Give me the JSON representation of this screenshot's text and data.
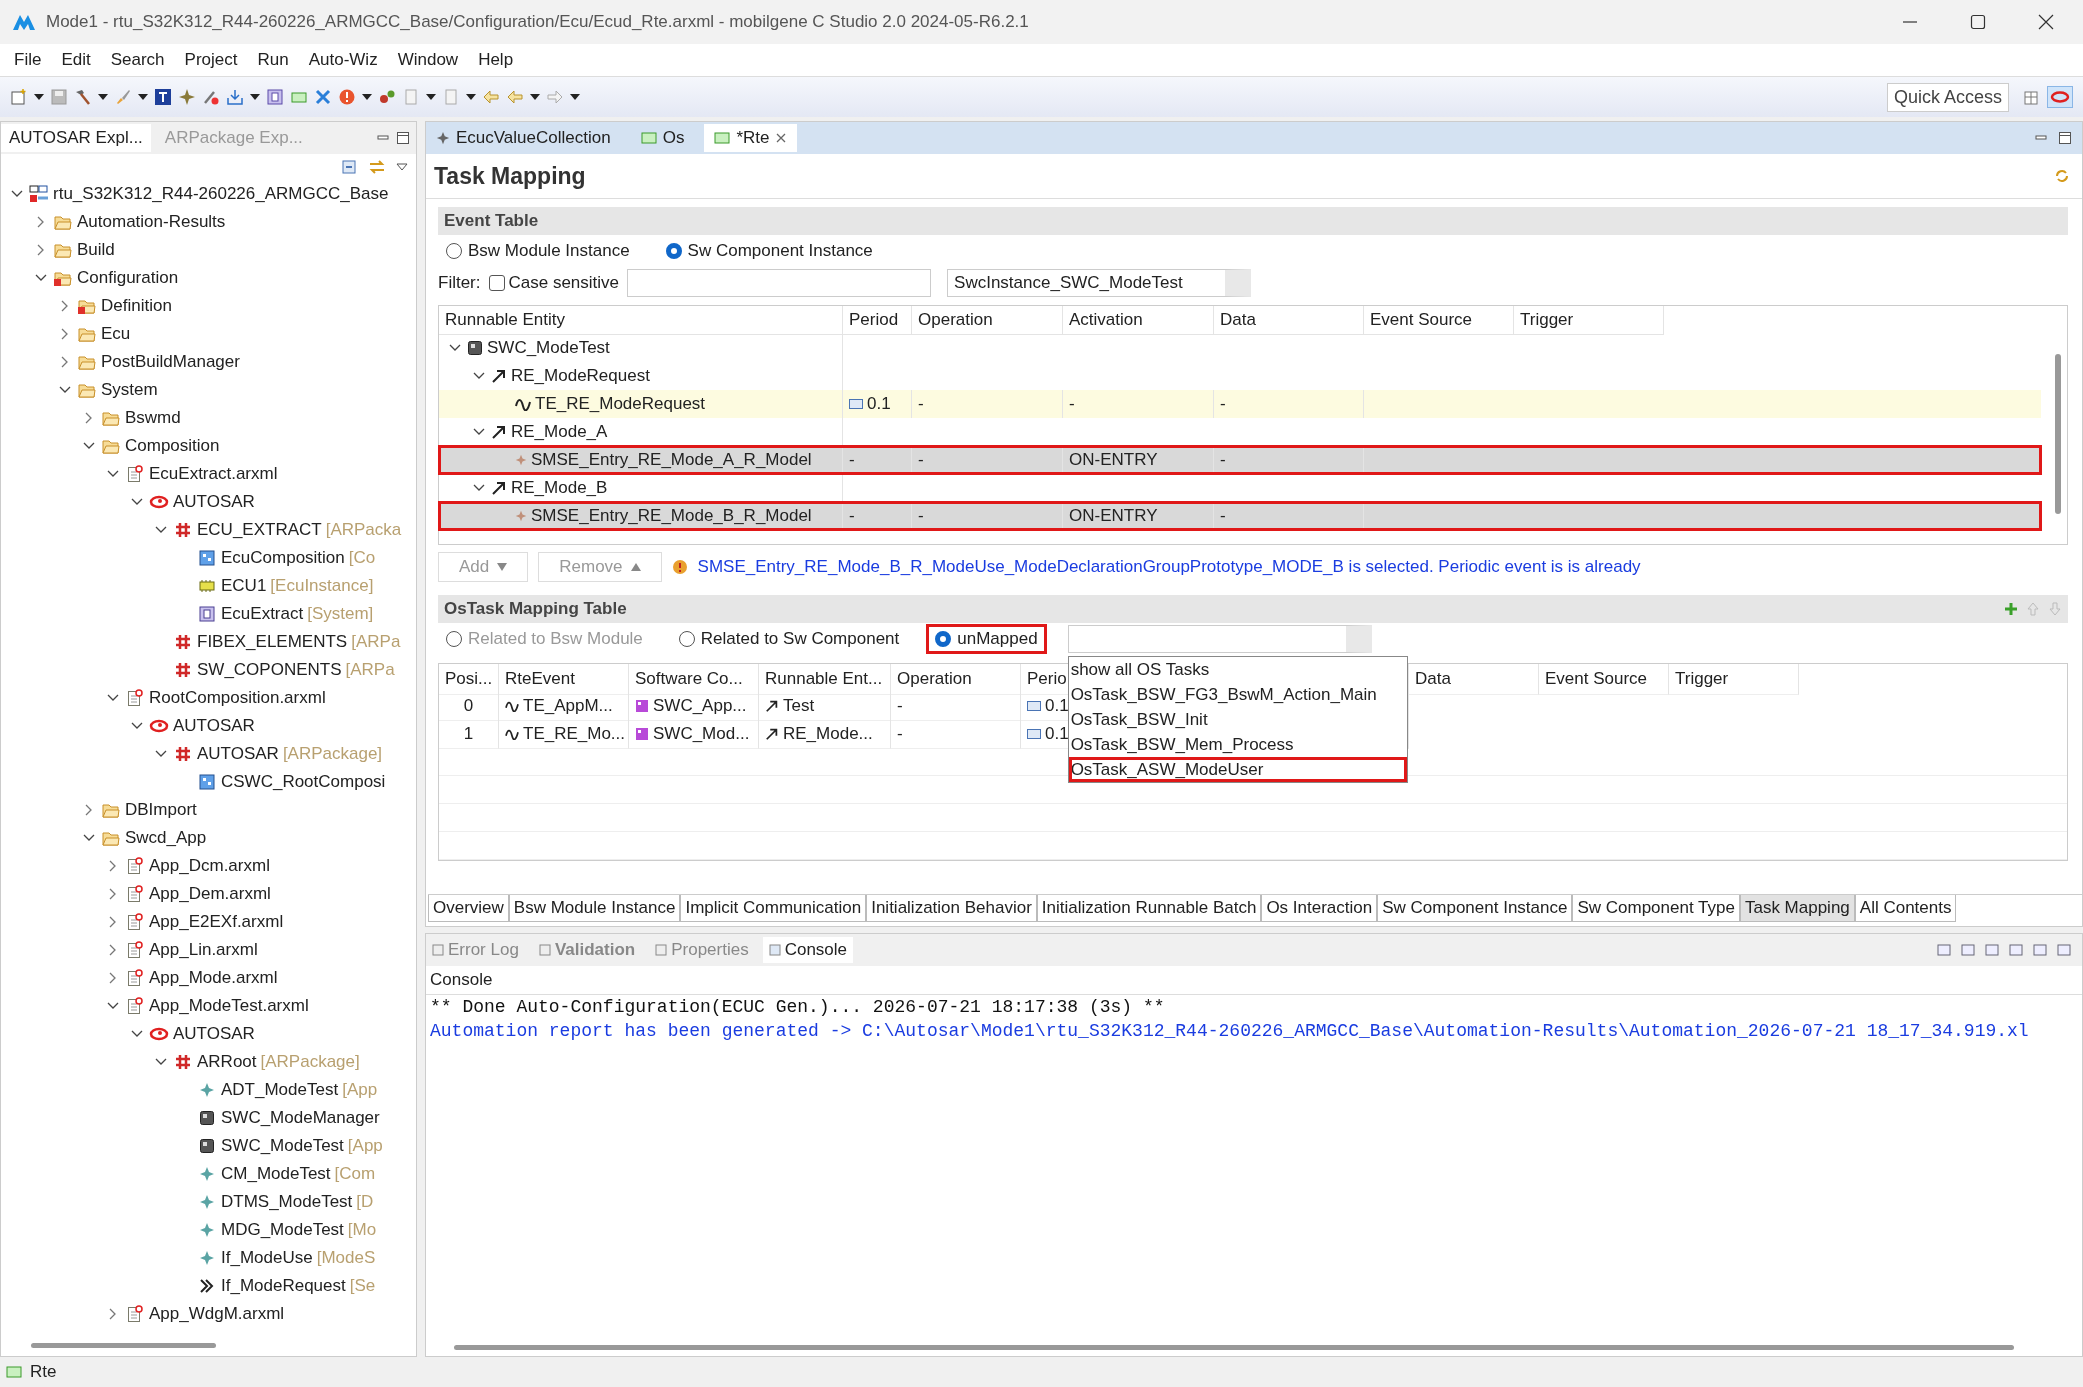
{
  "window": {
    "title": "Mode1 - rtu_S32K312_R44-260226_ARMGCC_Base/Configuration/Ecu/Ecud_Rte.arxml - mobilgene C Studio 2.0 2024-05-R6.2.1"
  },
  "menu": [
    "File",
    "Edit",
    "Search",
    "Project",
    "Run",
    "Auto-Wiz",
    "Window",
    "Help"
  ],
  "quick_access": "Quick Access",
  "left_tabs": [
    {
      "label": "AUTOSAR Expl...",
      "selected": true
    },
    {
      "label": "ARPackage Exp...",
      "selected": false
    }
  ],
  "tree": [
    {
      "label": "rtu_S32K312_R44-260226_ARMGCC_Base",
      "kind": "project",
      "expanded": true,
      "children": [
        {
          "label": "Automation-Results",
          "kind": "folder",
          "expanded": false
        },
        {
          "label": "Build",
          "kind": "folder",
          "expanded": false
        },
        {
          "label": "Configuration",
          "kind": "errfolder",
          "expanded": true,
          "children": [
            {
              "label": "Definition",
              "kind": "errfolder",
              "expanded": false
            },
            {
              "label": "Ecu",
              "kind": "folder",
              "expanded": false
            },
            {
              "label": "PostBuildManager",
              "kind": "folder",
              "expanded": false
            },
            {
              "label": "System",
              "kind": "folder",
              "expanded": true,
              "children": [
                {
                  "label": "Bswmd",
                  "kind": "folder",
                  "expanded": false
                },
                {
                  "label": "Composition",
                  "kind": "folder",
                  "expanded": true,
                  "children": [
                    {
                      "label": "EcuExtract.arxml",
                      "kind": "file",
                      "expanded": true,
                      "children": [
                        {
                          "label": "AUTOSAR",
                          "kind": "autosar",
                          "expanded": true,
                          "children": [
                            {
                              "label": "ECU_EXTRACT",
                              "type": "[ARPacka",
                              "kind": "package",
                              "expanded": true,
                              "children": [
                                {
                                  "label": "EcuComposition",
                                  "type": "[Co",
                                  "kind": "composition"
                                },
                                {
                                  "label": "ECU1",
                                  "type": "[EcuInstance]",
                                  "kind": "ecu"
                                },
                                {
                                  "label": "EcuExtract",
                                  "type": "[System]",
                                  "kind": "system"
                                }
                              ]
                            },
                            {
                              "label": "FIBEX_ELEMENTS",
                              "type": "[ARPa",
                              "kind": "package"
                            },
                            {
                              "label": "SW_COPONENTS",
                              "type": "[ARPa",
                              "kind": "package"
                            }
                          ]
                        }
                      ]
                    },
                    {
                      "label": "RootComposition.arxml",
                      "kind": "file",
                      "expanded": true,
                      "children": [
                        {
                          "label": "AUTOSAR",
                          "kind": "autosar",
                          "expanded": true,
                          "children": [
                            {
                              "label": "AUTOSAR",
                              "type": "[ARPackage]",
                              "kind": "package",
                              "expanded": true,
                              "children": [
                                {
                                  "label": "CSWC_RootComposi",
                                  "kind": "composition"
                                }
                              ]
                            }
                          ]
                        }
                      ]
                    }
                  ]
                },
                {
                  "label": "DBImport",
                  "kind": "folder",
                  "expanded": false
                },
                {
                  "label": "Swcd_App",
                  "kind": "folder",
                  "expanded": true,
                  "children": [
                    {
                      "label": "App_Dcm.arxml",
                      "kind": "file",
                      "expanded": false
                    },
                    {
                      "label": "App_Dem.arxml",
                      "kind": "file",
                      "expanded": false
                    },
                    {
                      "label": "App_E2EXf.arxml",
                      "kind": "file",
                      "expanded": false
                    },
                    {
                      "label": "App_Lin.arxml",
                      "kind": "file",
                      "expanded": false
                    },
                    {
                      "label": "App_Mode.arxml",
                      "kind": "file",
                      "expanded": false
                    },
                    {
                      "label": "App_ModeTest.arxml",
                      "kind": "file",
                      "expanded": true,
                      "children": [
                        {
                          "label": "AUTOSAR",
                          "kind": "autosar",
                          "expanded": true,
                          "children": [
                            {
                              "label": "ARRoot",
                              "type": "[ARPackage]",
                              "kind": "package",
                              "expanded": true,
                              "children": [
                                {
                                  "label": "ADT_ModeTest",
                                  "type": "[App",
                                  "kind": "element"
                                },
                                {
                                  "label": "SWC_ModeManager",
                                  "kind": "swc"
                                },
                                {
                                  "label": "SWC_ModeTest",
                                  "type": "[App",
                                  "kind": "swc"
                                },
                                {
                                  "label": "CM_ModeTest",
                                  "type": "[Com",
                                  "kind": "element"
                                },
                                {
                                  "label": "DTMS_ModeTest",
                                  "type": "[D",
                                  "kind": "element"
                                },
                                {
                                  "label": "MDG_ModeTest",
                                  "type": "[Mo",
                                  "kind": "element"
                                },
                                {
                                  "label": "If_ModeUse",
                                  "type": "[ModeS",
                                  "kind": "element"
                                },
                                {
                                  "label": "If_ModeRequest",
                                  "type": "[Se",
                                  "kind": "interface"
                                }
                              ]
                            }
                          ]
                        }
                      ]
                    },
                    {
                      "label": "App_WdgM.arxml",
                      "kind": "file",
                      "expanded": false
                    }
                  ]
                }
              ]
            }
          ]
        }
      ]
    }
  ],
  "editor_tabs": [
    {
      "label": "EcucValueCollection",
      "kind": "element",
      "selected": false
    },
    {
      "label": "Os",
      "kind": "editor",
      "selected": false
    },
    {
      "label": "*Rte",
      "kind": "editor",
      "selected": true
    }
  ],
  "page_title": "Task Mapping",
  "event_table": {
    "title": "Event Table",
    "radios": [
      {
        "label": "Bsw Module Instance",
        "selected": false
      },
      {
        "label": "Sw Component Instance",
        "selected": true
      }
    ],
    "filter_label": "Filter:",
    "case_sensitive": {
      "label": "Case sensitive",
      "checked": false
    },
    "instance": "SwcInstance_SWC_ModeTest",
    "columns": [
      "Runnable Entity",
      "Period",
      "Operation",
      "Activation",
      "Data",
      "Event Source",
      "Trigger"
    ],
    "rows": [
      {
        "name": "SWC_ModeTest",
        "kind": "swc",
        "expanded": true,
        "children": [
          {
            "name": "RE_ModeRequest",
            "kind": "runnable",
            "expanded": true,
            "children": [
              {
                "name": "TE_RE_ModeRequest",
                "kind": "timing",
                "selected": true,
                "outlined": false,
                "cells": [
                  "0.1",
                  "-",
                  "-",
                  "-"
                ]
              }
            ]
          },
          {
            "name": "RE_Mode_A",
            "kind": "runnable",
            "expanded": true,
            "children": [
              {
                "name": "SMSE_Entry_RE_Mode_A_R_Model",
                "kind": "mode",
                "selected": false,
                "outlined": true,
                "cells": [
                  "-",
                  "-",
                  "ON-ENTRY",
                  "-"
                ]
              }
            ]
          },
          {
            "name": "RE_Mode_B",
            "kind": "runnable",
            "expanded": true,
            "children": [
              {
                "name": "SMSE_Entry_RE_Mode_B_R_Model",
                "kind": "mode",
                "selected": false,
                "outlined": true,
                "cells": [
                  "-",
                  "-",
                  "ON-ENTRY",
                  "-"
                ]
              }
            ]
          }
        ]
      }
    ]
  },
  "actions": [
    {
      "label": "Add",
      "disabled": true
    },
    {
      "label": "Remove",
      "disabled": true
    }
  ],
  "message": "SMSE_Entry_RE_Mode_B_R_ModeUse_ModeDeclarationGroupPrototype_MODE_B is selected. Periodic event is is already",
  "ostask": {
    "title": "OsTask Mapping Table",
    "radios": [
      {
        "label": "Related to Bsw Module",
        "selected": false,
        "disabled": true,
        "outlined": false
      },
      {
        "label": "Related to Sw Component",
        "selected": false,
        "disabled": false,
        "outlined": false
      },
      {
        "label": "unMapped",
        "selected": true,
        "disabled": false,
        "outlined": true
      }
    ],
    "columns": [
      "Posi...",
      "RteEvent",
      "Software Co...",
      "Runnable Ent...",
      "Operation",
      "Perio",
      "Data",
      "Event Source",
      "Trigger"
    ],
    "rows": [
      [
        "0",
        "TE_AppM...",
        "SWC_App...",
        "Test",
        "-",
        "0.1"
      ],
      [
        "1",
        "TE_RE_Mo...",
        "SWC_Mod...",
        "RE_Mode...",
        "-",
        "0.1"
      ]
    ],
    "dropdown": [
      {
        "label": "show all OS Tasks",
        "outlined": false
      },
      {
        "label": "OsTask_BSW_FG3_BswM_Action_Main",
        "outlined": false
      },
      {
        "label": "OsTask_BSW_Init",
        "outlined": false
      },
      {
        "label": "OsTask_BSW_Mem_Process",
        "outlined": false
      },
      {
        "label": "OsTask_ASW_ModeUser",
        "outlined": true
      }
    ]
  },
  "page_tabs": [
    {
      "label": "Overview",
      "selected": false
    },
    {
      "label": "Bsw Module Instance",
      "selected": false
    },
    {
      "label": "Implicit Communication",
      "selected": false
    },
    {
      "label": "Initialization Behavior",
      "selected": false
    },
    {
      "label": "Initialization Runnable Batch",
      "selected": false
    },
    {
      "label": "Os Interaction",
      "selected": false
    },
    {
      "label": "Sw Component Instance",
      "selected": false
    },
    {
      "label": "Sw Component Type",
      "selected": false
    },
    {
      "label": "Task Mapping",
      "selected": true
    },
    {
      "label": "All Contents",
      "selected": false
    }
  ],
  "console_tabs": [
    {
      "label": "Error Log",
      "selected": false,
      "emphasized": false
    },
    {
      "label": "Validation",
      "selected": false,
      "emphasized": true
    },
    {
      "label": "Properties",
      "selected": false,
      "emphasized": false
    },
    {
      "label": "Console",
      "selected": true,
      "emphasized": false
    }
  ],
  "console": {
    "title": "Console",
    "lines": [
      {
        "text": "** Done Auto-Configuration(ECUC Gen.)... 2026-07-21 18:17:38 (3s) **",
        "kind": "info"
      },
      {
        "text": "Automation report has been generated -> C:\\Autosar\\Mode1\\rtu_S32K312_R44-260226_ARMGCC_Base\\Automation-Results\\Automation_2026-07-21 18_17_34.919.xl",
        "kind": "link"
      }
    ]
  },
  "status_bar": "Rte"
}
